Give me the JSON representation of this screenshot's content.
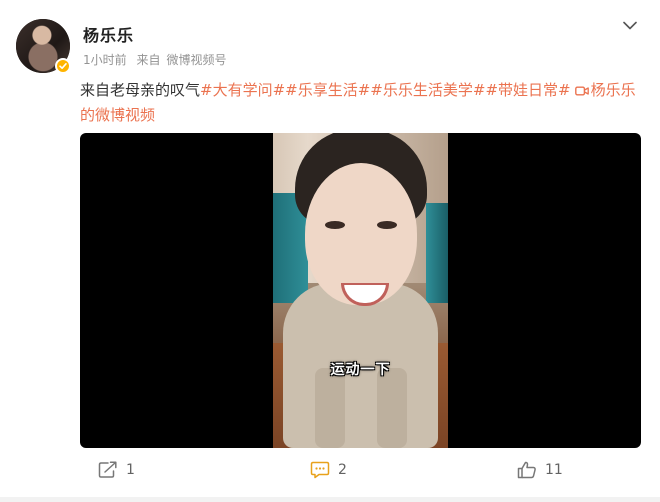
{
  "user": {
    "name": "杨乐乐",
    "time": "1小时前",
    "source_prefix": "来自",
    "source": "微博视频号"
  },
  "post": {
    "text_prefix": "来自老母亲的叹气",
    "topics": [
      "#大有学问#",
      "#乐享生活#",
      "#乐乐生活美学#",
      "#带娃日常#"
    ],
    "video_link_line1": "杨乐乐",
    "video_link_line2": "的微博视频"
  },
  "video": {
    "caption": "运动一下"
  },
  "actions": {
    "repost_count": "1",
    "comment_count": "2",
    "like_count": "11"
  },
  "colors": {
    "link": "#eb7350",
    "text": "#333333",
    "meta": "#939393",
    "comment_icon": "#e8a11b",
    "verified": "#ffb400"
  },
  "icons": [
    "chevron-down-icon",
    "verified-icon",
    "video-icon",
    "repost-icon",
    "comment-icon",
    "like-icon"
  ]
}
